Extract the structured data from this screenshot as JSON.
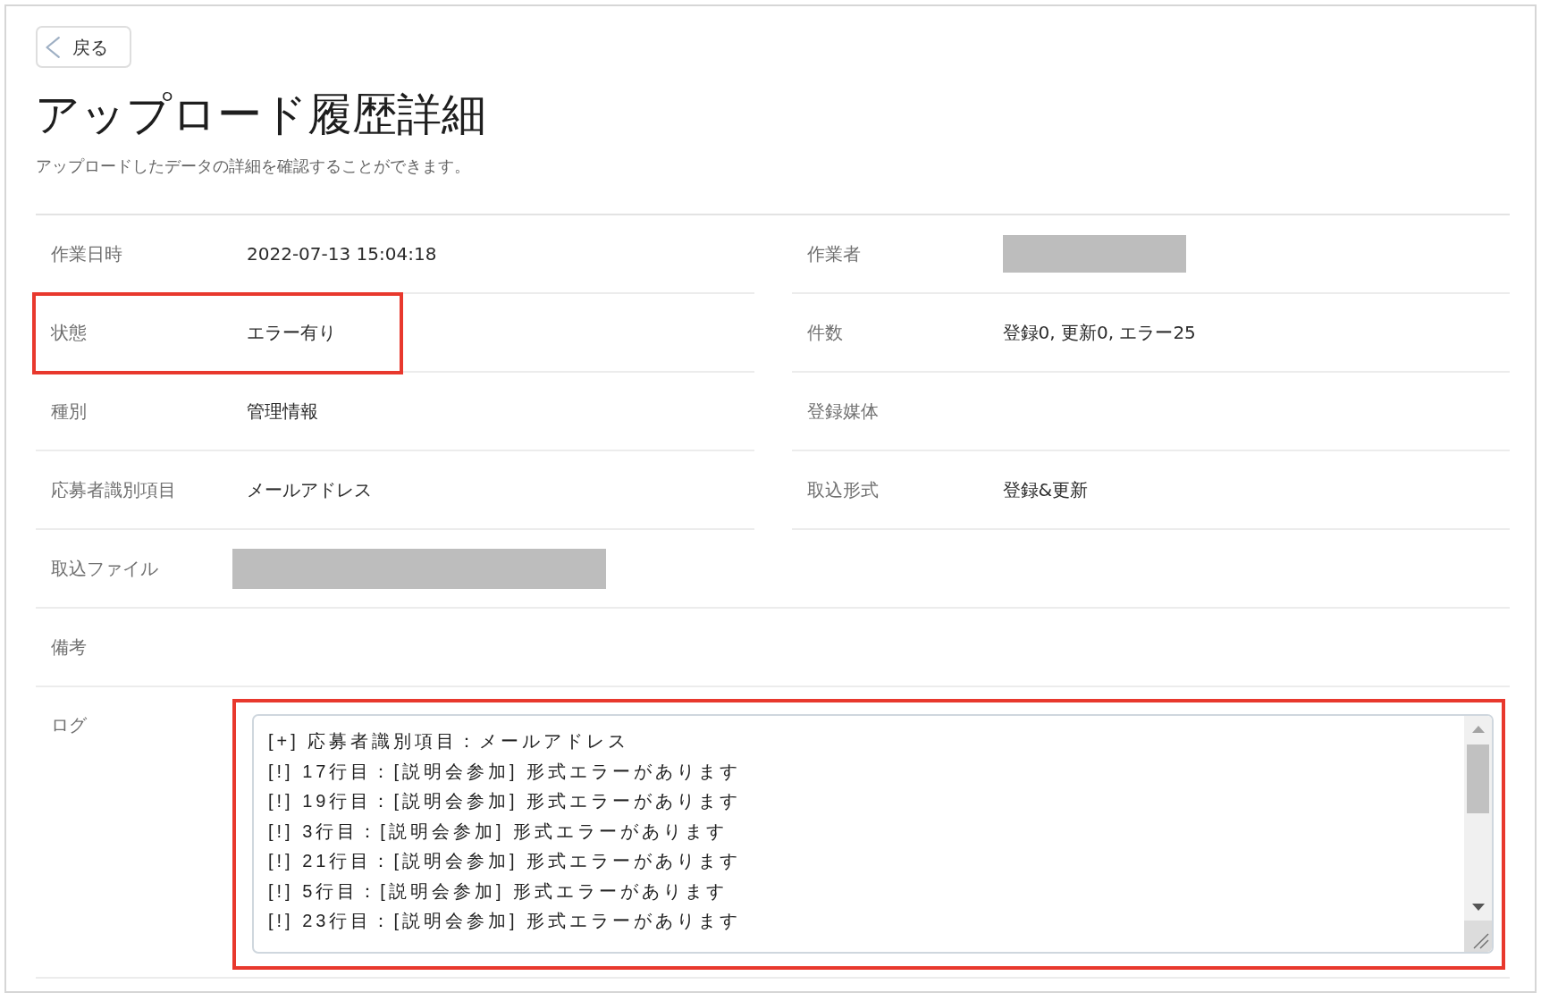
{
  "back_button": {
    "label": "戻る"
  },
  "title": "アップロード履歴詳細",
  "subtitle": "アップロードしたデータの詳細を確認することができます。",
  "fields": [
    {
      "kind": "half",
      "label": "作業日時",
      "value": "2022-07-13 15:04:18",
      "redacted": false,
      "highlighted": false
    },
    {
      "kind": "half",
      "label": "作業者",
      "redacted": true,
      "highlighted": false
    },
    {
      "kind": "half",
      "label": "状態",
      "value": "エラー有り",
      "redacted": false,
      "highlighted": true
    },
    {
      "kind": "half",
      "label": "件数",
      "value": "登録0, 更新0, エラー25",
      "redacted": false,
      "highlighted": false
    },
    {
      "kind": "half",
      "label": "種別",
      "value": "管理情報",
      "redacted": false,
      "highlighted": false
    },
    {
      "kind": "half",
      "label": "登録媒体",
      "redacted": false,
      "highlighted": false
    },
    {
      "kind": "half",
      "label": "応募者識別項目",
      "value": "メールアドレス",
      "redacted": false,
      "highlighted": false
    },
    {
      "kind": "half",
      "label": "取込形式",
      "value": "登録&更新",
      "redacted": false,
      "highlighted": false
    },
    {
      "kind": "full",
      "label": "取込ファイル",
      "redacted": true,
      "highlighted": false
    },
    {
      "kind": "full",
      "label": "備考",
      "redacted": false,
      "highlighted": false
    },
    {
      "kind": "log",
      "label": "ログ",
      "redacted": false,
      "highlighted": true,
      "lines": [
        "[+] 応募者識別項目：メールアドレス",
        "[!] 17行目：[説明会参加] 形式エラーがあります",
        "[!] 19行目：[説明会参加] 形式エラーがあります",
        "[!] 3行目：[説明会参加] 形式エラーがあります",
        "[!] 21行目：[説明会参加] 形式エラーがあります",
        "[!] 5行目：[説明会参加] 形式エラーがあります",
        "[!] 23行目：[説明会参加] 形式エラーがあります"
      ]
    }
  ]
}
